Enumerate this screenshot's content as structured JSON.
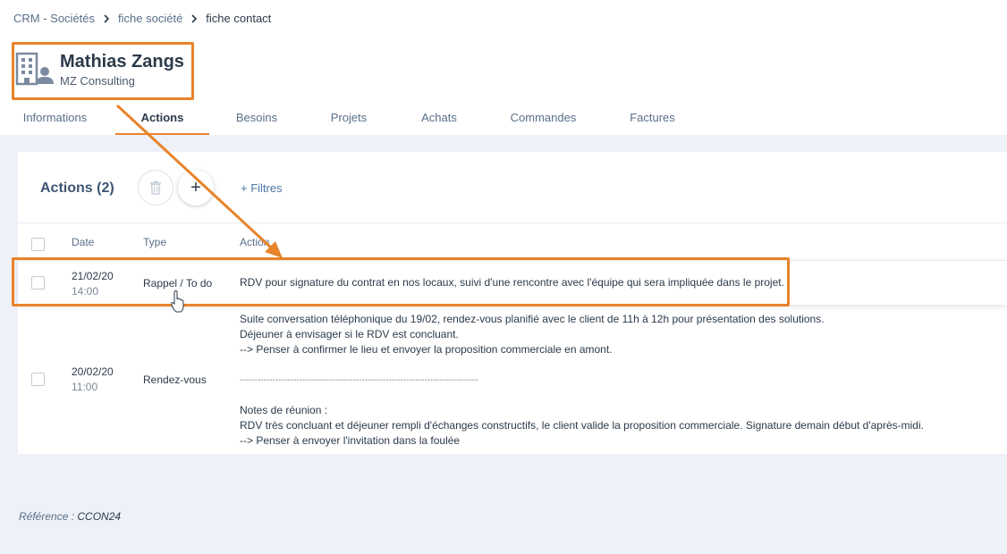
{
  "breadcrumb": {
    "items": [
      "CRM - Sociétés",
      "fiche société"
    ],
    "current": "fiche contact"
  },
  "contact": {
    "name": "Mathias Zangs",
    "company": "MZ Consulting"
  },
  "tabs": [
    "Informations",
    "Actions",
    "Besoins",
    "Projets",
    "Achats",
    "Commandes",
    "Factures"
  ],
  "active_tab": "Actions",
  "actions_panel": {
    "title": "Actions (2)",
    "add_symbol": "+",
    "filters_label": "+ Filtres"
  },
  "table": {
    "headers": {
      "date": "Date",
      "type": "Type",
      "action": "Action"
    },
    "rows": [
      {
        "date": "21/02/20",
        "time": "14:00",
        "type": "Rappel / To do",
        "action_lines": [
          "RDV pour signature du contrat en nos locaux, suivi d'une rencontre avec l'équipe qui sera impliquée dans le projet."
        ]
      },
      {
        "date": "20/02/20",
        "time": "11:00",
        "type": "Rendez-vous",
        "action_lines": [
          "Suite conversation téléphonique du 19/02, rendez-vous planifié avec le client de 11h à 12h pour présentation des solutions.",
          "Déjeuner à envisager si le RDV est concluant.",
          "--> Penser à confirmer le lieu et envoyer la proposition commerciale en amont.",
          "",
          "--------------------------------------------------------------------------------",
          "",
          "Notes de réunion :",
          "RDV très concluant et déjeuner rempli d'échanges constructifs, le client valide la proposition commerciale. Signature demain début d'après-midi.",
          "--> Penser à envoyer l'invitation dans la foulée"
        ]
      }
    ]
  },
  "reference": {
    "label": "Référence :",
    "value": "CCON24"
  },
  "colors": {
    "accent": "#e8832a",
    "page_bg": "#eef1f7",
    "link": "#4f77a8"
  }
}
